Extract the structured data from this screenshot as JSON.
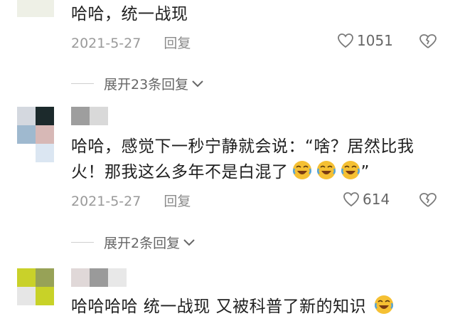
{
  "comments": [
    {
      "text": "哈哈，统一战现",
      "date": "2021-5-27",
      "reply_label": "回复",
      "likes": "1051",
      "expand_label": "展开23条回复"
    },
    {
      "text_line1": "哈哈，感觉下一秒宁静就会说：“啥？居然比我",
      "text_line2": "火！那我这么多年不是白混了",
      "text_line2_tail": "”",
      "date": "2021-5-27",
      "reply_label": "回复",
      "likes": "614",
      "expand_label": "展开2条回复"
    },
    {
      "text": "哈哈哈哈 统一战现 又被科普了新的知识"
    }
  ],
  "icons": {
    "like": "heart-icon",
    "dislike": "broken-heart-icon",
    "expand": "chevron-down-icon",
    "emoji": "laughing-crying-emoji"
  },
  "colors": {
    "text": "#1f1f1f",
    "meta": "#9a9a9a",
    "icon": "#7a7a7a",
    "emoji": "#f5c033"
  }
}
